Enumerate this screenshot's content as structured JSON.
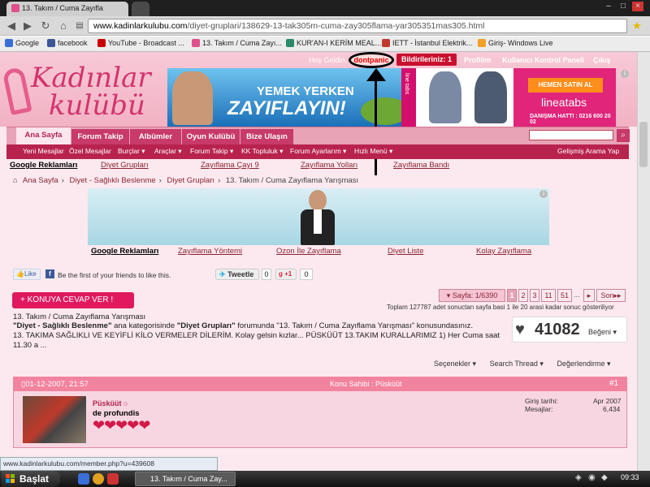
{
  "browser": {
    "tab_title": "13. Takım / Cuma Zayıfla",
    "url_domain": "www.kadinlarkulubu.com",
    "url_path": "/diyet-gruplari/138629-13-tak305m-cuma-zay305flama-yar305351mas305.html",
    "bookmarks": [
      {
        "label": "Google",
        "color": "#3a6fd8"
      },
      {
        "label": "facebook",
        "color": "#3b5998"
      },
      {
        "label": "YouTube - Broadcast ...",
        "color": "#cc0000"
      },
      {
        "label": "13. Takım / Cuma Zayı...",
        "color": "#e0508a"
      },
      {
        "label": "KUR'AN-I KERİM MEAL...",
        "color": "#2a8a6a"
      },
      {
        "label": "IETT - İstanbul Elektrik...",
        "color": "#c0392b"
      },
      {
        "label": "Giriş- Windows Live",
        "color": "#f2a02a"
      }
    ]
  },
  "site": {
    "logo_line1": "Kadınlar",
    "logo_line2": "kulübü",
    "greeting": "Hoş Geldin,",
    "username_link": "dontpanic",
    "notifications": "Bildirileriniz: 1",
    "profile": "Profilim",
    "control_panel": "Kullanıcı Kontrol Paneli",
    "logout": "Çıkış"
  },
  "banner": {
    "line1": "YEMEK YERKEN",
    "line2": "ZAYIFLAYIN!",
    "strip": "line tabs",
    "buy": "HEMEN SATIN AL",
    "brand": "lineatabs",
    "hotline": "DANIŞMA HATTI : 0216 600 20 02"
  },
  "nav": {
    "tabs": [
      "Ana Sayfa",
      "Forum Takip",
      "Albümler",
      "Oyun Kulübü",
      "Bize Ulaşın"
    ],
    "sub": [
      "Yeni Mesajlar",
      "Özel Mesajlar",
      "Burçlar ▾",
      "Araçlar ▾",
      "Forum Takip ▾",
      "KK Topluluk ▾",
      "Forum Ayarlarım ▾",
      "Hızlı Menü ▾"
    ],
    "advanced_search": "Gelişmiş Arama Yap"
  },
  "ads_top": {
    "google": "Google Reklamları",
    "links": [
      "Diyet Grupları",
      "Zayıflama Çayı 9",
      "Zayıflama Yolları",
      "Zayıflama Bandı"
    ]
  },
  "breadcrumb": [
    "Ana Sayfa",
    "Diyet - Sağlıklı Beslenme",
    "Diyet Grupları",
    "13. Takım / Cuma Zayıflama Yarışması"
  ],
  "ads_mid": {
    "google": "Google Reklamları",
    "links": [
      "Zayıflama Yöntemi",
      "Ozon İle Zayıflama",
      "Diyet Liste",
      "Kolay Zayıflama"
    ]
  },
  "social": {
    "like": "Like",
    "fb_text": "Be the first of your friends to like this.",
    "tweet": "Tweetle",
    "tweet_count": "0",
    "gplus": "+1",
    "gplus_count": "0"
  },
  "reply_button": "+ KONUYA CEVAP VER !",
  "pager": {
    "label": "Sayfa: 1/6390",
    "pages": [
      "1",
      "2",
      "3",
      "11",
      "51"
    ],
    "ellipsis": "...",
    "next": "Son",
    "info": "Toplam 127787 adet sonuctan sayfa basi 1 ile 20 arasi kadar sonuc gösteriliyor"
  },
  "thread": {
    "title": "13. Takım / Cuma Zayıflama Yarışması",
    "desc_part1": "\"Diyet - Sağlıklı Beslenme\"",
    "desc_part2": " ana kategorisinde ",
    "desc_part3": "\"Diyet Grupları\"",
    "desc_part4": " forumunda \"13. Takım / Cuma Zayıflama Yarışması\" konusundasınız.",
    "desc_line2": "13. TAKIMA SAĞLIKLI VE KEYİFLİ KİLO VERMELER DİLERİM. Kolay gelsin kızlar... PÜSKÜÜT 13.TAKIM KURALLARIMIZ 1) Her Cuma saat",
    "desc_line3": "11.30 a ...",
    "likes": "41082",
    "likes_label": "Beğeni ▾"
  },
  "tools": [
    "Seçenekler ▾",
    "Search Thread ▾",
    "Değerlendirme ▾"
  ],
  "post": {
    "date": "01-12-2007,   21:57",
    "owner": "Konu Sahibi : Püsküüt",
    "number": "#1",
    "username": "Püsküüt ○",
    "title": "de profundis",
    "hearts": "❤❤❤❤❤",
    "join_label": "Giriş tarihi:",
    "join_value": "Apr 2007",
    "posts_label": "Mesajlar:",
    "posts_value": "6,434"
  },
  "status_url": "www.kadinlarkulubu.com/member.php?u=439608",
  "taskbar": {
    "start": "Başlat",
    "item": "13. Takım / Cuma Zay...",
    "clock": "09:33"
  }
}
